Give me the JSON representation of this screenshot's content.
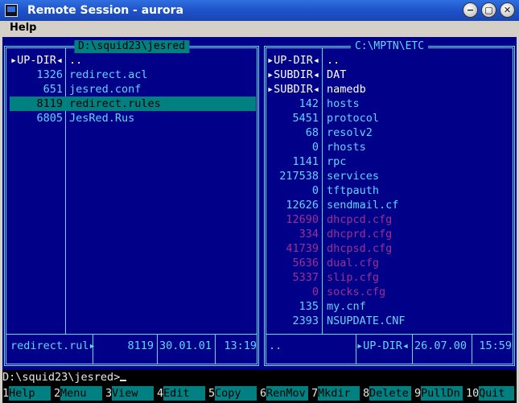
{
  "window": {
    "title": "Remote Session - aurora",
    "minimize_glyph": "−",
    "maximize_glyph": "▢",
    "close_glyph": "✕"
  },
  "menubar": {
    "help": "Help"
  },
  "left_panel": {
    "title": "D:\\squid23\\jesred",
    "rows": [
      {
        "size": "▸UP-DIR◂",
        "name": ".."
      },
      {
        "size": "1326",
        "name": "redirect.acl"
      },
      {
        "size": "651",
        "name": "jesred.conf"
      },
      {
        "size": "8119",
        "name": "redirect.rules"
      },
      {
        "size": "6805",
        "name": "JesRed.Rus"
      }
    ],
    "status": {
      "name": "redirect.rul▸",
      "size": "8119",
      "date": "30.01.01",
      "time": "13:19"
    }
  },
  "right_panel": {
    "title": "C:\\MPTN\\ETC",
    "rows": [
      {
        "size": "▸UP-DIR◂",
        "name": ".."
      },
      {
        "size": "▸SUBDIR◂",
        "name": "DAT"
      },
      {
        "size": "▸SUBDIR◂",
        "name": "namedb"
      },
      {
        "size": "142",
        "name": "hosts"
      },
      {
        "size": "5451",
        "name": "protocol"
      },
      {
        "size": "68",
        "name": "resolv2"
      },
      {
        "size": "0",
        "name": "rhosts"
      },
      {
        "size": "1141",
        "name": "rpc"
      },
      {
        "size": "217538",
        "name": "services"
      },
      {
        "size": "0",
        "name": "tftpauth"
      },
      {
        "size": "12626",
        "name": "sendmail.cf"
      },
      {
        "size": "12690",
        "name": "dhcpcd.cfg"
      },
      {
        "size": "334",
        "name": "dhcprd.cfg"
      },
      {
        "size": "41739",
        "name": "dhcpsd.cfg"
      },
      {
        "size": "5636",
        "name": "dual.cfg"
      },
      {
        "size": "5337",
        "name": "slip.cfg"
      },
      {
        "size": "0",
        "name": "socks.cfg"
      },
      {
        "size": "135",
        "name": "my.cnf"
      },
      {
        "size": "2393",
        "name": "NSUPDATE.CNF"
      }
    ],
    "status": {
      "name": "..",
      "size": "▸UP-DIR◂",
      "date": "26.07.00",
      "time": "15:59"
    }
  },
  "command_line": {
    "prompt": "D:\\squid23\\jesred>"
  },
  "function_keys": [
    {
      "num": "1",
      "label": "Help"
    },
    {
      "num": "2",
      "label": "Menu"
    },
    {
      "num": "3",
      "label": "View"
    },
    {
      "num": "4",
      "label": "Edit"
    },
    {
      "num": "5",
      "label": "Copy"
    },
    {
      "num": "6",
      "label": "RenMov"
    },
    {
      "num": "7",
      "label": "Mkdir"
    },
    {
      "num": "8",
      "label": "Delete"
    },
    {
      "num": "9",
      "label": "PullDn"
    },
    {
      "num": "10",
      "label": "Quit"
    }
  ],
  "colors": {
    "panel_bg": "#000088",
    "border": "#5fd7ff",
    "selection": "#008080",
    "hidden_file": "#a0308f"
  }
}
